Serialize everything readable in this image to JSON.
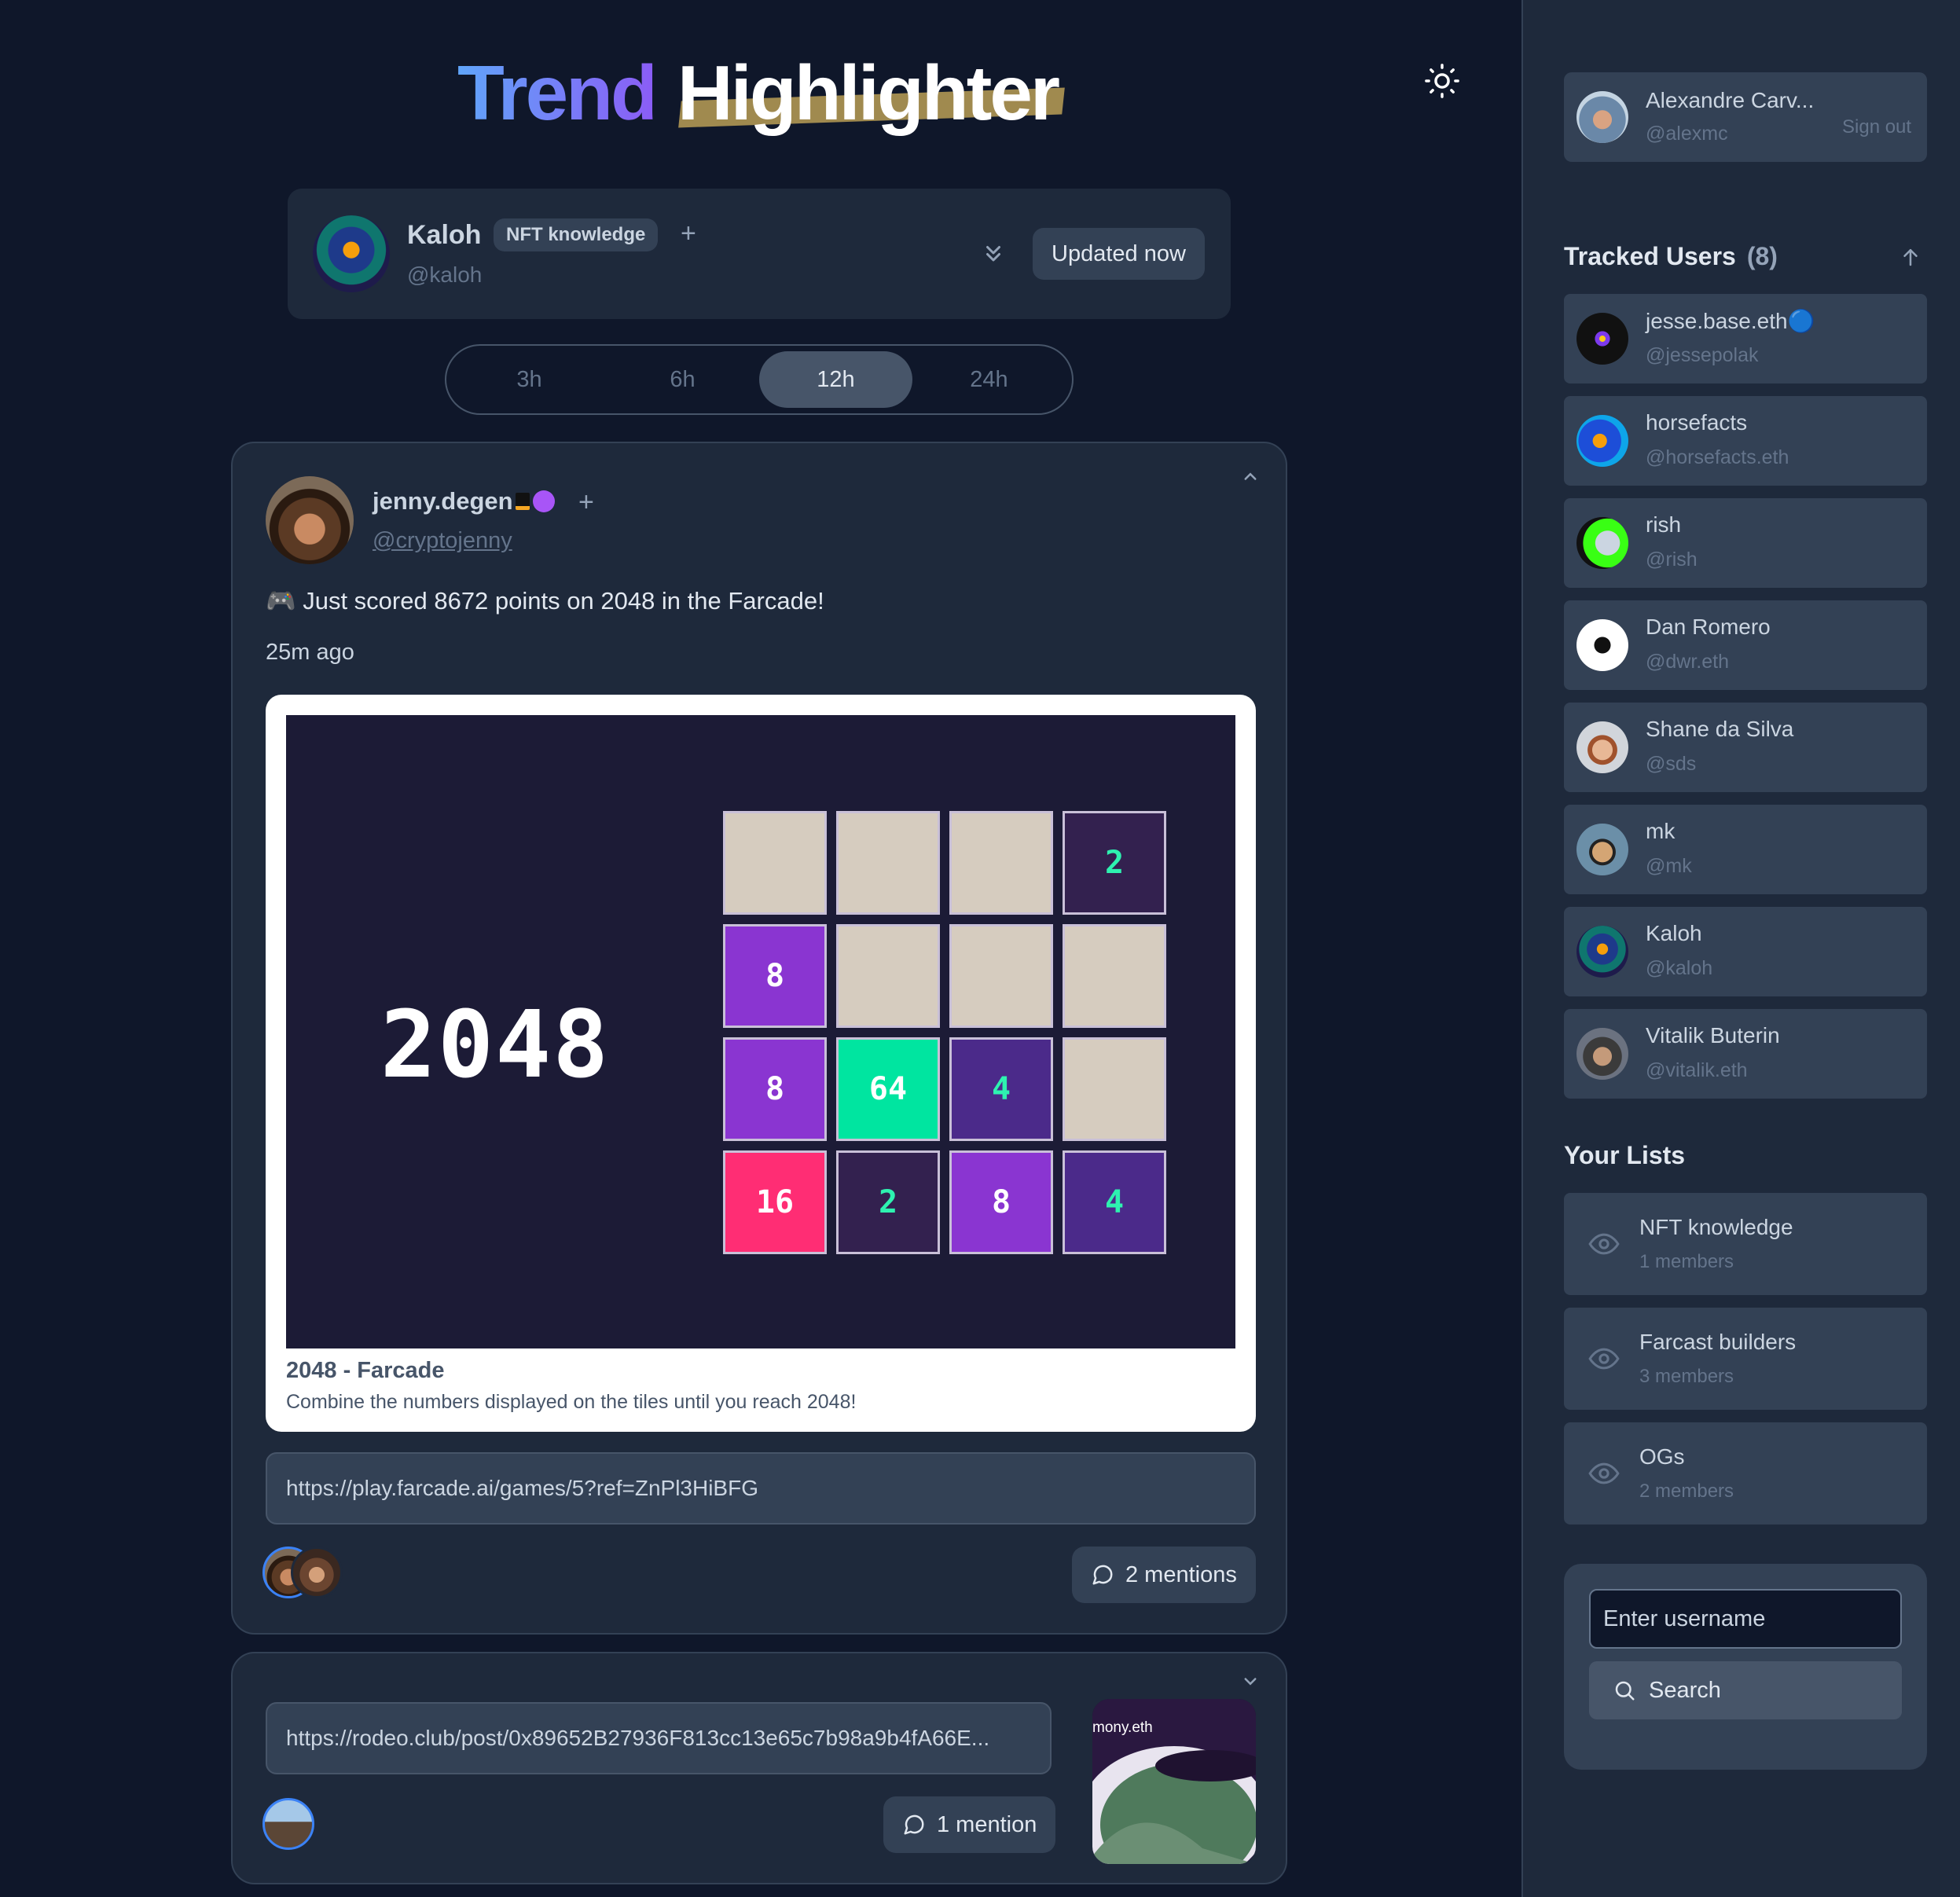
{
  "header": {
    "logo_part1": "Trend",
    "logo_part2": "Highlighter",
    "theme_icon": "sun-icon"
  },
  "profile": {
    "name": "Kaloh",
    "handle": "@kaloh",
    "badge": "NFT knowledge",
    "updated_label": "Updated now"
  },
  "time_tabs": [
    {
      "label": "3h",
      "active": false
    },
    {
      "label": "6h",
      "active": false
    },
    {
      "label": "12h",
      "active": true
    },
    {
      "label": "24h",
      "active": false
    }
  ],
  "posts": [
    {
      "author_name": "jenny.degen",
      "author_handle": "@cryptojenny",
      "text": "🎮 Just scored 8672 points on 2048 in the Farcade!",
      "time": "25m ago",
      "embed": {
        "title": "2048 - Farcade",
        "description": "Combine the numbers displayed on the tiles until you reach 2048!",
        "game_title": "2048",
        "tiles": [
          [
            "",
            "",
            "",
            "2"
          ],
          [
            "8",
            "",
            "",
            ""
          ],
          [
            "8",
            "64",
            "4",
            ""
          ],
          [
            "16",
            "2",
            "8",
            "4"
          ]
        ]
      },
      "url": "https://play.farcade.ai/games/5?ref=ZnPl3HiBFG",
      "mentions": "2 mentions"
    },
    {
      "url": "https://rodeo.club/post/0x89652B27936F813cc13e65c7b98a9b4fA66E...",
      "mentions": "1 mention",
      "thumb_label": "mony.eth"
    }
  ],
  "sidebar": {
    "current_user": {
      "name": "Alexandre Carv...",
      "handle": "@alexmc",
      "sign_out": "Sign out"
    },
    "tracked_title": "Tracked Users",
    "tracked_count": "(8)",
    "tracked_users": [
      {
        "name": "jesse.base.eth🔵",
        "handle": "@jessepolak"
      },
      {
        "name": "horsefacts",
        "handle": "@horsefacts.eth"
      },
      {
        "name": "rish",
        "handle": "@rish"
      },
      {
        "name": "Dan Romero",
        "handle": "@dwr.eth"
      },
      {
        "name": "Shane da Silva",
        "handle": "@sds"
      },
      {
        "name": "mk",
        "handle": "@mk"
      },
      {
        "name": "Kaloh",
        "handle": "@kaloh"
      },
      {
        "name": "Vitalik Buterin",
        "handle": "@vitalik.eth"
      }
    ],
    "lists_title": "Your Lists",
    "lists": [
      {
        "name": "NFT knowledge",
        "members": "1 members"
      },
      {
        "name": "Farcast builders",
        "members": "3 members"
      },
      {
        "name": "OGs",
        "members": "2 members"
      }
    ],
    "search": {
      "placeholder": "Enter username",
      "button_label": "Search"
    }
  },
  "colors": {
    "background": "#0f172a",
    "card": "#1e293b",
    "surface": "#334155",
    "tile_empty": "#d6ccbf",
    "tile_dark": "#33214f",
    "tile_purple": "#8a35d1",
    "tile_green": "#00e5a0",
    "tile_pink": "#ff2d74",
    "accent": "#3b82f6"
  }
}
